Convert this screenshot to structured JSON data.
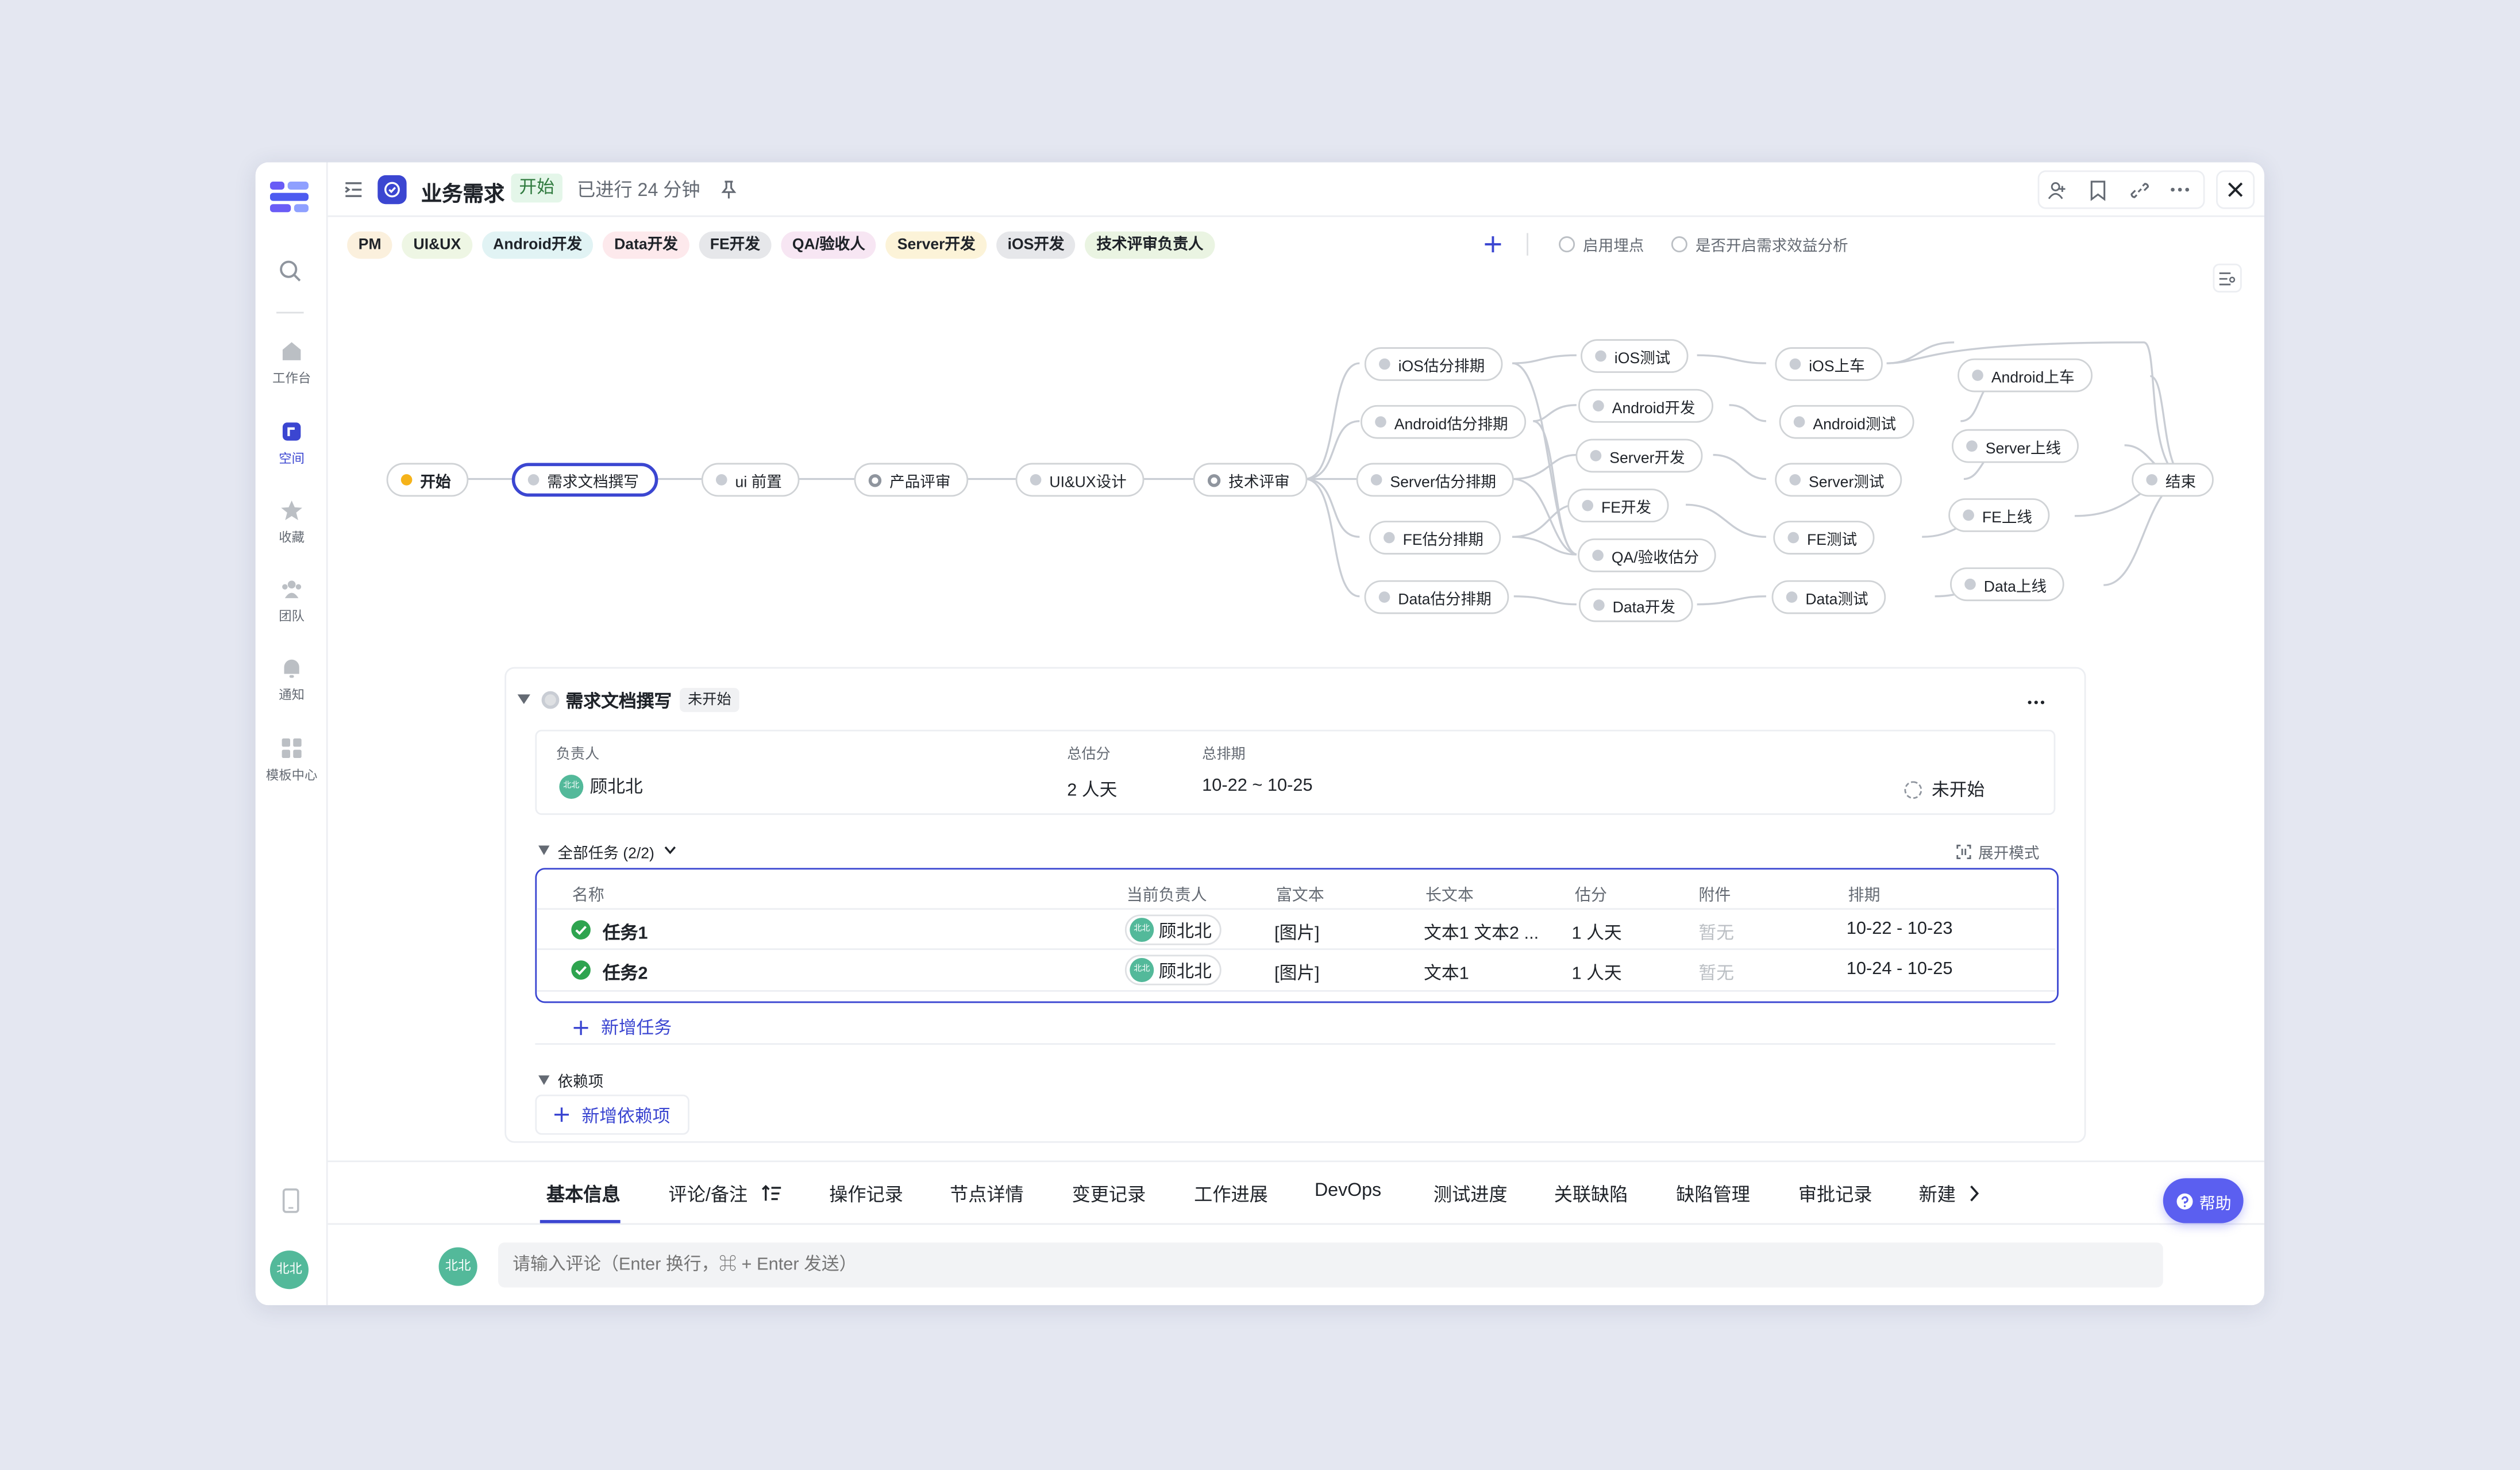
{
  "rail": {
    "items": [
      {
        "label": "工作台",
        "icon": "home-icon"
      },
      {
        "label": "空间",
        "icon": "space-icon"
      },
      {
        "label": "收藏",
        "icon": "star-icon"
      },
      {
        "label": "团队",
        "icon": "team-icon"
      },
      {
        "label": "通知",
        "icon": "bell-icon"
      },
      {
        "label": "模板中心",
        "icon": "template-icon"
      }
    ],
    "avatar": "北北"
  },
  "header": {
    "title": "业务需求",
    "status": "开始",
    "elapsed": "已进行 24 分钟"
  },
  "roles": [
    {
      "label": "PM",
      "color": "#fbf0dd"
    },
    {
      "label": "UI&UX",
      "color": "#eef6e4"
    },
    {
      "label": "Android开发",
      "color": "#e1f3f4"
    },
    {
      "label": "Data开发",
      "color": "#fde9ec"
    },
    {
      "label": "FE开发",
      "color": "#e6e7ea"
    },
    {
      "label": "QA/验收人",
      "color": "#f7e6f3"
    },
    {
      "label": "Server开发",
      "color": "#fcf3d8"
    },
    {
      "label": "iOS开发",
      "color": "#e6e7ea"
    },
    {
      "label": "技术评审负责人",
      "color": "#eaf4e2"
    }
  ],
  "options": {
    "tracking": "启用埋点",
    "benefit": "是否开启需求效益分析"
  },
  "flow": {
    "start": "开始",
    "doc": "需求文档撰写",
    "ui_pre": "ui 前置",
    "product_review": "产品评审",
    "uiux": "UI&UX设计",
    "tech_review": "技术评审",
    "ios_est": "iOS估分排期",
    "android_est": "Android估分排期",
    "server_est": "Server估分排期",
    "fe_est": "FE估分排期",
    "data_est": "Data估分排期",
    "ios_test": "iOS测试",
    "android_dev": "Android开发",
    "server_dev": "Server开发",
    "fe_dev": "FE开发",
    "qa_est": "QA/验收估分",
    "data_dev": "Data开发",
    "ios_launch": "iOS上车",
    "android_test": "Android测试",
    "server_test": "Server测试",
    "fe_test": "FE测试",
    "data_test": "Data测试",
    "android_launch": "Android上车",
    "server_online": "Server上线",
    "fe_online": "FE上线",
    "data_online": "Data上线",
    "end": "结束"
  },
  "node": {
    "name": "需求文档撰写",
    "status": "未开始",
    "owner_label": "负责人",
    "owner": "顾北北",
    "owner_avatar": "北北",
    "estimate_label": "总估分",
    "estimate": "2 人天",
    "schedule_label": "总排期",
    "schedule": "10-22 ~ 10-25",
    "progress": "未开始"
  },
  "tasks": {
    "header": "全部任务 (2/2)",
    "expand": "展开模式",
    "columns": [
      "名称",
      "当前负责人",
      "富文本",
      "长文本",
      "估分",
      "附件",
      "排期"
    ],
    "rows": [
      {
        "name": "任务1",
        "owner": "顾北北",
        "rich": "[图片]",
        "long": "文本1 文本2 ...",
        "est": "1 人天",
        "attach": "暂无",
        "schedule": "10-22 - 10-23"
      },
      {
        "name": "任务2",
        "owner": "顾北北",
        "rich": "[图片]",
        "long": "文本1",
        "est": "1 人天",
        "attach": "暂无",
        "schedule": "10-24 - 10-25"
      }
    ],
    "add": "新增任务"
  },
  "deps": {
    "header": "依赖项",
    "add": "新增依赖项"
  },
  "tabs": [
    "基本信息",
    "评论/备注",
    "操作记录",
    "节点详情",
    "变更记录",
    "工作进展",
    "DevOps",
    "测试进度",
    "关联缺陷",
    "缺陷管理",
    "审批记录",
    "新建"
  ],
  "comment": {
    "avatar": "北北",
    "placeholder": "请输入评论（Enter 换行，⌘ + Enter 发送）"
  },
  "help": "帮助",
  "colors": {
    "accent": "#3b46d1",
    "help": "#5b5ff0",
    "avatar": "#53b99a",
    "success": "#2ea44f"
  }
}
